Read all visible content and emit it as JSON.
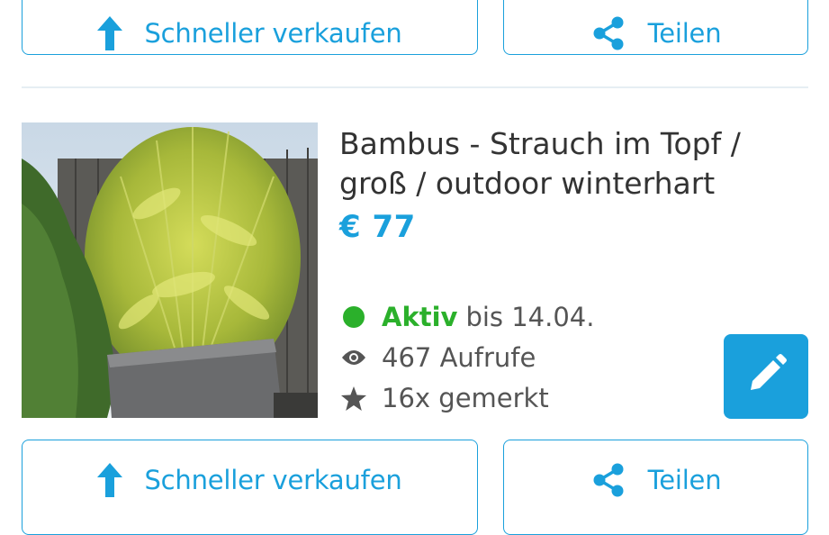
{
  "buttons": {
    "sell_label": "Schneller verkaufen",
    "share_label": "Teilen"
  },
  "listing": {
    "title_line1": "Bambus - Strauch im Topf /",
    "title_line2": "groß / outdoor winterhart",
    "price": "€ 77",
    "status_word": "Aktiv",
    "status_rest": "bis 14.04.",
    "views": "467 Aufrufe",
    "favorites": "16x gemerkt"
  },
  "icons": {
    "sell": "arrow-up-icon",
    "share": "share-icon",
    "views": "eye-icon",
    "favorites": "star-icon",
    "edit": "pencil-icon",
    "status": "status-dot"
  },
  "colors": {
    "accent": "#1aa0dc",
    "active": "#2bb02b",
    "text": "#333333",
    "muted": "#555555",
    "border": "#1aa0dc"
  }
}
